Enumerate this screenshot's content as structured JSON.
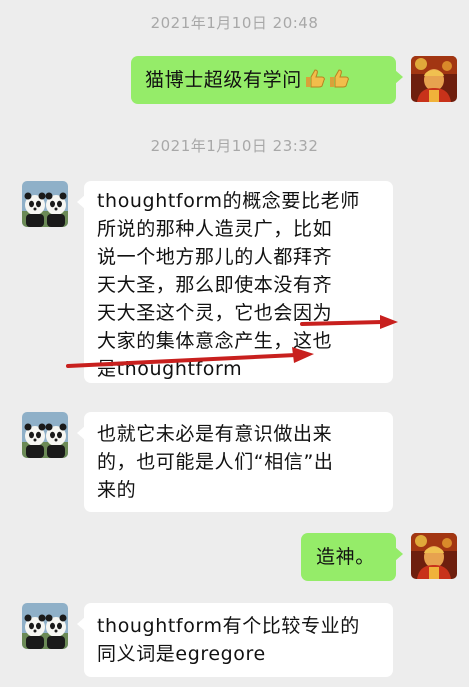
{
  "messages": {
    "ts1": "2021年1月10日 20:48",
    "m1": {
      "text": "猫博士超级有学问",
      "emoji": [
        "thumbs-up-icon",
        "thumbs-up-icon"
      ]
    },
    "ts2": "2021年1月10日 23:32",
    "m2": {
      "lines": [
        "thoughtform的概念要比老师",
        "所说的那种人造灵广，比如",
        "说一个地方那儿的人都拜齐",
        "天大圣，那么即使本没有齐",
        "天大圣这个灵，它也会因为",
        "大家的集体意念产生，这也",
        "是thoughtform"
      ]
    },
    "m3": {
      "lines": [
        "也就它未必是有意识做出来",
        "的，也可能是人们“相信”出",
        "来的"
      ]
    },
    "m4": {
      "text": "造神。"
    },
    "m5": {
      "lines": [
        "thoughtform有个比较专业的",
        "同义词是egregore"
      ]
    }
  },
  "colors": {
    "background": "#ededed",
    "sent_bubble": "#95ec69",
    "received_bubble": "#ffffff",
    "timestamp": "#a8a8a8",
    "annotation_arrow": "#c8201e"
  },
  "icons": {
    "self_avatar": "monk-avatar-icon",
    "other_avatar": "panda-avatar-icon"
  }
}
